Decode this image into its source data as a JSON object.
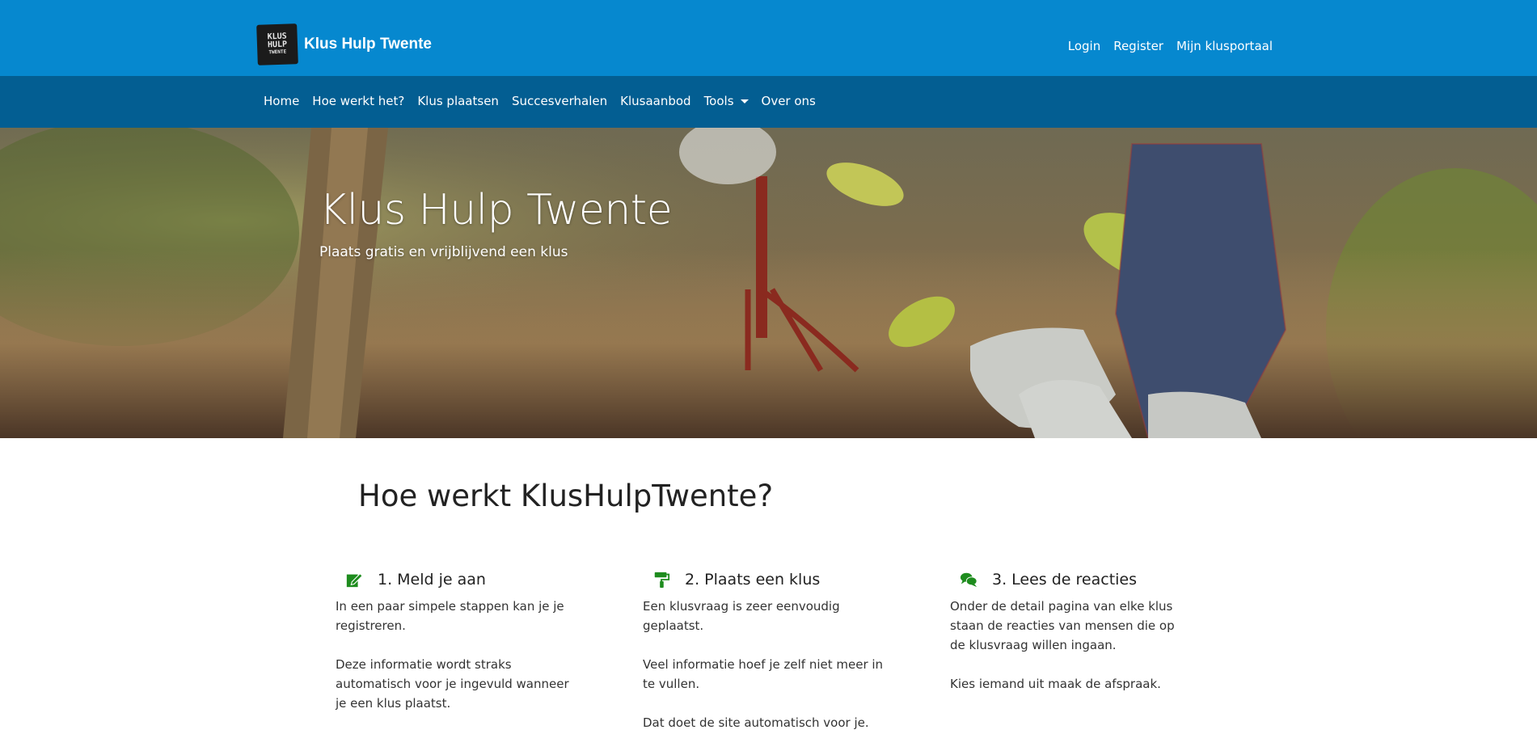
{
  "header": {
    "logo_lines": [
      "KLUS",
      "HULP",
      "TWENTE"
    ],
    "brand_name": "Klus Hulp Twente",
    "user_links": [
      "Login",
      "Register",
      "Mijn klusportaal"
    ]
  },
  "nav": {
    "items": [
      "Home",
      "Hoe werkt het?",
      "Klus plaatsen",
      "Succesverhalen",
      "Klusaanbod",
      "Tools",
      "Over ons"
    ]
  },
  "hero": {
    "title": "Klus Hulp Twente",
    "subtitle": "Plaats gratis en vrijblijvend een klus"
  },
  "how": {
    "title": "Hoe werkt KlusHulpTwente?",
    "steps": [
      {
        "icon": "edit-icon",
        "title": "1. Meld je aan",
        "text": "In een paar simpele stappen kan je je registreren.\n\nDeze informatie wordt straks automatisch voor je ingevuld wanneer je een klus plaatst."
      },
      {
        "icon": "paint-roller-icon",
        "title": "2. Plaats een klus",
        "text": "Een klusvraag is zeer eenvoudig geplaatst.\n\nVeel informatie hoef je zelf niet meer in te vullen.\n\nDat doet de site automatisch voor je."
      },
      {
        "icon": "comments-icon",
        "title": "3. Lees de reacties",
        "text": "Onder de detail pagina van elke klus staan de reacties van mensen die op de klusvraag willen ingaan.\n\nKies iemand uit maak de afspraak."
      }
    ]
  },
  "colors": {
    "topbar": "#0688cf",
    "navbar": "#035e92",
    "icon_green": "#1e8c1e"
  }
}
